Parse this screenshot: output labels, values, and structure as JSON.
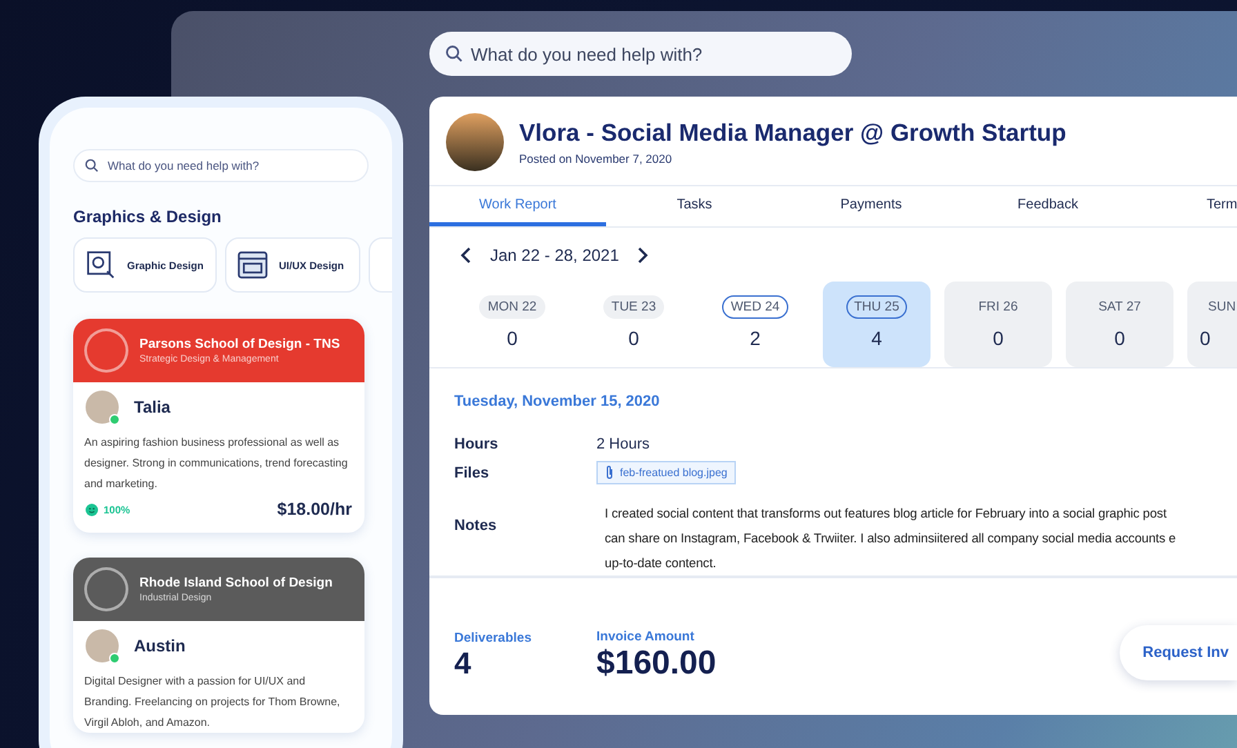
{
  "top_search": {
    "placeholder": "What do you need help with?"
  },
  "job": {
    "title": "Vlora - Social Media Manager @ Growth Startup",
    "posted": "Posted on November 7, 2020"
  },
  "tabs": [
    {
      "label": "Work Report",
      "selected": true
    },
    {
      "label": "Tasks",
      "selected": false
    },
    {
      "label": "Payments",
      "selected": false
    },
    {
      "label": "Feedback",
      "selected": false
    },
    {
      "label": "Term",
      "selected": false
    }
  ],
  "week": {
    "range": "Jan 22 - 28, 2021"
  },
  "days": [
    {
      "label": "MON 22",
      "count": "0",
      "kind": "past",
      "selected": false
    },
    {
      "label": "TUE 23",
      "count": "0",
      "kind": "past",
      "selected": false
    },
    {
      "label": "WED 24",
      "count": "2",
      "kind": "logged",
      "selected": false
    },
    {
      "label": "THU 25",
      "count": "4",
      "kind": "logged",
      "selected": true
    },
    {
      "label": "FRI 26",
      "count": "0",
      "kind": "upcoming",
      "selected": false
    },
    {
      "label": "SAT 27",
      "count": "0",
      "kind": "upcoming",
      "selected": false
    },
    {
      "label": "SUN",
      "count": "0",
      "kind": "upcoming",
      "selected": false
    }
  ],
  "report": {
    "date": "Tuesday, November 15, 2020",
    "hours_label": "Hours",
    "hours": "2 Hours",
    "files_label": "Files",
    "file": "feb-freatued blog.jpeg",
    "notes_label": "Notes",
    "notes": [
      "I created social content that transforms out features blog article for February into a social graphic post",
      "can share on Instagram, Facebook & Trwiiter. I also adminsiitered all company social media accounts e",
      "up-to-date contenct."
    ]
  },
  "footer": {
    "deliverables_label": "Deliverables",
    "deliverables": "4",
    "invoice_label": "Invoice Amount",
    "invoice": "$160.00",
    "button": "Request Inv"
  },
  "phone": {
    "search": {
      "placeholder": "What do you need help with?"
    },
    "section": "Graphics & Design",
    "categories": [
      {
        "label": "Graphic Design",
        "kind": "graphic"
      },
      {
        "label": "UI/UX Design",
        "kind": "uiux"
      }
    ],
    "cards": [
      {
        "school": "Parsons School of Design - TNS",
        "program": "Strategic Design & Management",
        "color": "#e53a2f",
        "name": "Talia",
        "online": true,
        "bio": "An aspiring fashion business professional as well as designer. Strong in communications, trend forecasting and marketing.",
        "rating": "100%",
        "rate": "$18.00/hr"
      },
      {
        "school": "Rhode Island School of Design",
        "program": "Industrial Design",
        "color": "#5b5b5b",
        "name": "Austin",
        "online": true,
        "bio": "Digital Designer with a passion for UI/UX and Branding. Freelancing on projects for Thom Browne, Virgil Abloh, and Amazon."
      }
    ]
  }
}
